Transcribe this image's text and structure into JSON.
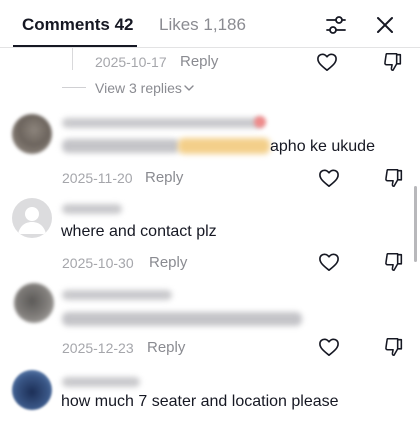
{
  "header": {
    "comments_tab": "Comments 42",
    "likes_tab": "Likes 1,186",
    "filter_icon": "filter-sliders-icon",
    "close_icon": "close-icon"
  },
  "thread_reply": {
    "date": "2025-10-17",
    "reply_label": "Reply",
    "view_replies": "View 3 replies"
  },
  "comments": [
    {
      "username": "",
      "text_visible": "apho ke ukude",
      "date": "2025-11-20",
      "reply_label": "Reply"
    },
    {
      "username": "",
      "text": "where and contact plz",
      "date": "2025-10-30",
      "reply_label": "Reply"
    },
    {
      "username": "",
      "text": "",
      "date": "2025-12-23",
      "reply_label": "Reply"
    },
    {
      "username": "",
      "text": "how much 7 seater and location please"
    }
  ],
  "colors": {
    "text_primary": "#161823",
    "text_secondary": "#8a8b91",
    "text_date": "#a5a6ab",
    "divider": "#e3e3e4"
  }
}
